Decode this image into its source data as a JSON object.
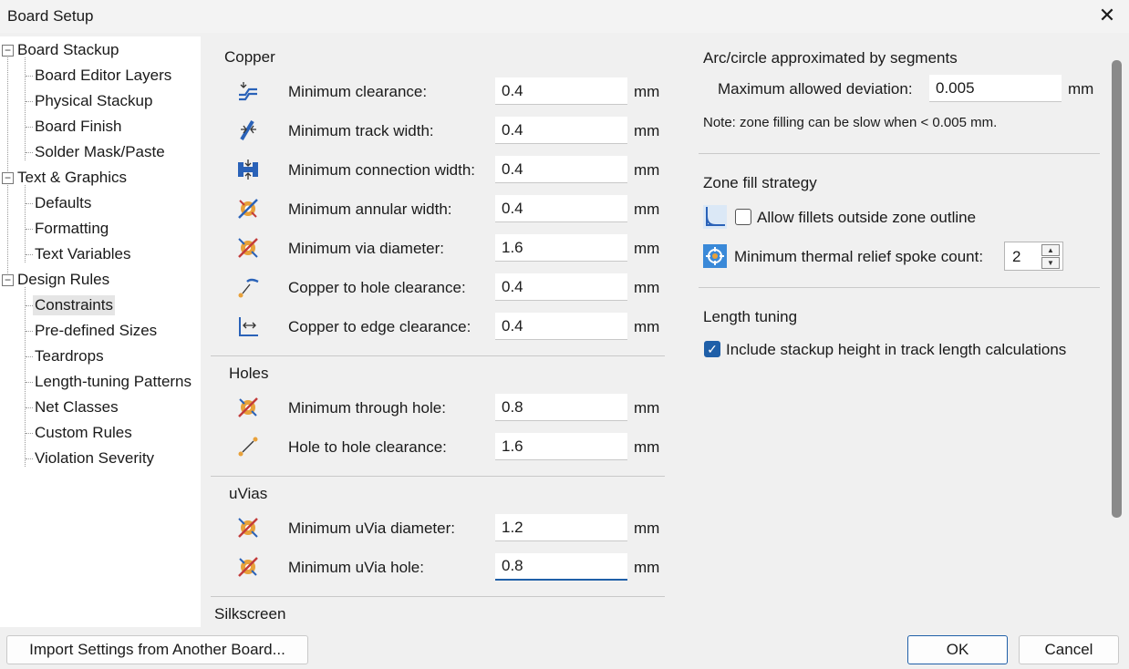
{
  "window": {
    "title": "Board Setup"
  },
  "tree": {
    "items": [
      {
        "label": "Board Stackup"
      },
      {
        "label": "Board Editor Layers"
      },
      {
        "label": "Physical Stackup"
      },
      {
        "label": "Board Finish"
      },
      {
        "label": "Solder Mask/Paste"
      },
      {
        "label": "Text & Graphics"
      },
      {
        "label": "Defaults"
      },
      {
        "label": "Formatting"
      },
      {
        "label": "Text Variables"
      },
      {
        "label": "Design Rules"
      },
      {
        "label": "Constraints"
      },
      {
        "label": "Pre-defined Sizes"
      },
      {
        "label": "Teardrops"
      },
      {
        "label": "Length-tuning Patterns"
      },
      {
        "label": "Net Classes"
      },
      {
        "label": "Custom Rules"
      },
      {
        "label": "Violation Severity"
      }
    ],
    "selected": "Constraints",
    "toggle_collapse": "−"
  },
  "copper": {
    "title": "Copper",
    "rows": [
      {
        "label": "Minimum clearance:",
        "value": "0.4",
        "unit": "mm",
        "icon": "clearance-icon"
      },
      {
        "label": "Minimum track width:",
        "value": "0.4",
        "unit": "mm",
        "icon": "track-width-icon"
      },
      {
        "label": "Minimum connection width:",
        "value": "0.4",
        "unit": "mm",
        "icon": "connection-width-icon"
      },
      {
        "label": "Minimum annular width:",
        "value": "0.4",
        "unit": "mm",
        "icon": "annular-width-icon"
      },
      {
        "label": "Minimum via diameter:",
        "value": "1.6",
        "unit": "mm",
        "icon": "via-diameter-icon"
      },
      {
        "label": "Copper to hole clearance:",
        "value": "0.4",
        "unit": "mm",
        "icon": "hole-clearance-icon"
      },
      {
        "label": "Copper to edge clearance:",
        "value": "0.4",
        "unit": "mm",
        "icon": "edge-clearance-icon"
      }
    ]
  },
  "holes": {
    "title": "Holes",
    "rows": [
      {
        "label": "Minimum through hole:",
        "value": "0.8",
        "unit": "mm",
        "icon": "through-hole-icon"
      },
      {
        "label": "Hole to hole clearance:",
        "value": "1.6",
        "unit": "mm",
        "icon": "hole-to-hole-icon"
      }
    ]
  },
  "uvias": {
    "title": "uVias",
    "rows": [
      {
        "label": "Minimum uVia diameter:",
        "value": "1.2",
        "unit": "mm",
        "icon": "uvia-diameter-icon"
      },
      {
        "label": "Minimum uVia hole:",
        "value": "0.8",
        "unit": "mm",
        "icon": "uvia-hole-icon"
      }
    ]
  },
  "silkscreen": {
    "title": "Silkscreen"
  },
  "arc": {
    "title": "Arc/circle approximated by segments",
    "deviation_label": "Maximum allowed deviation:",
    "deviation_value": "0.005",
    "deviation_unit": "mm",
    "note": "Note: zone filling can be slow when < 0.005 mm."
  },
  "zone": {
    "title": "Zone fill strategy",
    "fillets_label": "Allow fillets outside zone outline",
    "fillets_checked": false,
    "spoke_label": "Minimum thermal relief spoke count:",
    "spoke_value": "2"
  },
  "length": {
    "title": "Length tuning",
    "stackup_label": "Include stackup height in track length calculations",
    "stackup_checked": true
  },
  "buttons": {
    "import": "Import Settings from Another Board...",
    "ok": "OK",
    "cancel": "Cancel"
  },
  "colors": {
    "accent": "#1f5fa8",
    "icon_blue": "#2a62b8",
    "icon_orange": "#e8a13a",
    "icon_red": "#c23b3b"
  }
}
